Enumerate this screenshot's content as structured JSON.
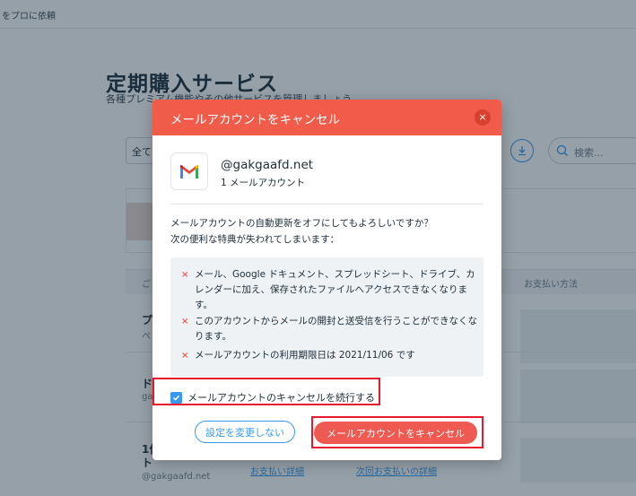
{
  "background": {
    "top_link": "をプロに依頼",
    "title": "定期購入サービス",
    "subtitle": "各種プレミアム機能やその他サービスを管理しましょう。",
    "filter_value": "全て",
    "search_placeholder": "検索...",
    "table_head_left": "ご",
    "table_head_right": "お支払い方法",
    "rows": [
      {
        "title": "プ",
        "sub": "ペ"
      },
      {
        "title": "ド",
        "sub": "ga"
      },
      {
        "title": "1作",
        "sub": "ト"
      }
    ],
    "row_email": "@gakgaafd.net",
    "link_payment": "お支払い詳細",
    "link_next_payment": "次回お支払いの詳細"
  },
  "modal": {
    "title": "メールアカウントをキャンセル",
    "close_icon": "×",
    "account_email": "@gakgaafd.net",
    "account_sub": "1 メールアカウント",
    "question_line1": "メールアカウントの自動更新をオフにしてもよろしいですか？",
    "question_line2": "次の便利な特典が失われてしまいます：",
    "lose_items": [
      {
        "icon": "×",
        "text": "メール、Google ドキュメント、スプレッドシート、ドライブ、カレンダーに加え、保存されたファイルへアクセスできなくなります。"
      },
      {
        "icon": "×",
        "text": "このアカウントからメールの開封と送受信を行うことができなくなります。"
      },
      {
        "icon": "×",
        "text": "メールアカウントの利用期限日は 2021/11/06 です"
      }
    ],
    "confirm_label": "メールアカウントのキャンセルを続行する",
    "confirm_checked": true,
    "keep_button": "設定を変更しない",
    "cancel_button": "メールアカウントをキャンセル"
  },
  "colors": {
    "header": "#f15b49",
    "cancel_button": "#ee5951",
    "accent": "#3899ec",
    "highlight": "#e8192c"
  },
  "icons": {
    "logo": "gmail-icon",
    "close": "close-icon",
    "download": "download-icon",
    "search": "search-icon",
    "lose": "x-mark-icon",
    "check": "check-icon"
  }
}
